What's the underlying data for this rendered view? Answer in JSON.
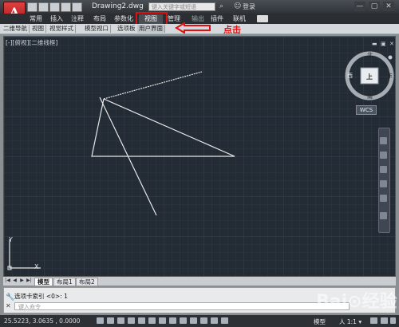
{
  "window": {
    "app_logo": "A",
    "doc_title": "Drawing2.dwg",
    "search_placeholder": "键入关键字或短语",
    "login": "登录",
    "controls": [
      "—",
      "▢",
      "✕"
    ]
  },
  "ribbon": {
    "tabs": [
      "常用",
      "插入",
      "注释",
      "布局",
      "参数化",
      "视图",
      "管理",
      "输出",
      "插件",
      "联机"
    ],
    "active_tab": "视图",
    "panels": [
      "二维导航",
      "视图",
      "视觉样式",
      "模型视口",
      "选项板",
      "用户界面"
    ]
  },
  "annotation": {
    "text": "点击",
    "color": "#e01010"
  },
  "viewport": {
    "label": "[-][俯视][二维线框]",
    "viewcube": {
      "north": "北",
      "south": "南",
      "east": "东",
      "west": "西",
      "face": "上"
    },
    "wcs": "WCS"
  },
  "ucs": {
    "x": "X",
    "y": "Y"
  },
  "layout_tabs": [
    "模型",
    "布局1",
    "布局2"
  ],
  "command": {
    "history": "选项卡索引 <0>: 1",
    "prompt_placeholder": "键入命令"
  },
  "status": {
    "coords": "25.5223,  3.0635  , 0.0000",
    "model": "模型",
    "scale": "人 1:1 ▾"
  },
  "watermark": "Bai⊙经验",
  "colors": {
    "drawing_bg": "#232b35",
    "highlight": "#e01010",
    "line": "#e8e8e8"
  }
}
